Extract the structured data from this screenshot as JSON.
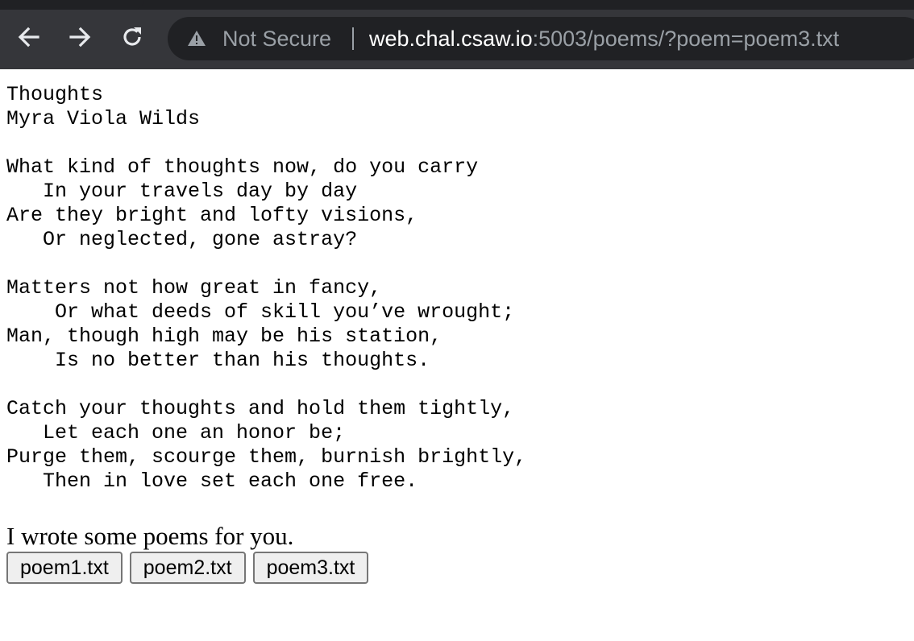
{
  "browser": {
    "not_secure_label": "Not Secure",
    "url_host": "web.chal.csaw.io",
    "url_rest": ":5003/poems/?poem=poem3.txt",
    "colors": {
      "chrome": "#35363a",
      "tab_strip": "#202124",
      "omnibox": "#202124",
      "url_host": "#ffffff",
      "url_dim": "#9aa0a6"
    },
    "icons": [
      "back-arrow-icon",
      "forward-arrow-icon",
      "reload-icon",
      "warning-triangle-icon"
    ]
  },
  "poem": {
    "text": "Thoughts\nMyra Viola Wilds\n\nWhat kind of thoughts now, do you carry\n   In your travels day by day\nAre they bright and lofty visions,\n   Or neglected, gone astray?\n\nMatters not how great in fancy,\n    Or what deeds of skill you’ve wrought;\nMan, though high may be his station,\n    Is no better than his thoughts.\n\nCatch your thoughts and hold them tightly,\n   Let each one an honor be;\nPurge them, scourge them, burnish brightly,\n   Then in love set each one free."
  },
  "intro": "I wrote some poems for you.",
  "buttons": [
    {
      "label": "poem1.txt"
    },
    {
      "label": "poem2.txt"
    },
    {
      "label": "poem3.txt"
    }
  ]
}
